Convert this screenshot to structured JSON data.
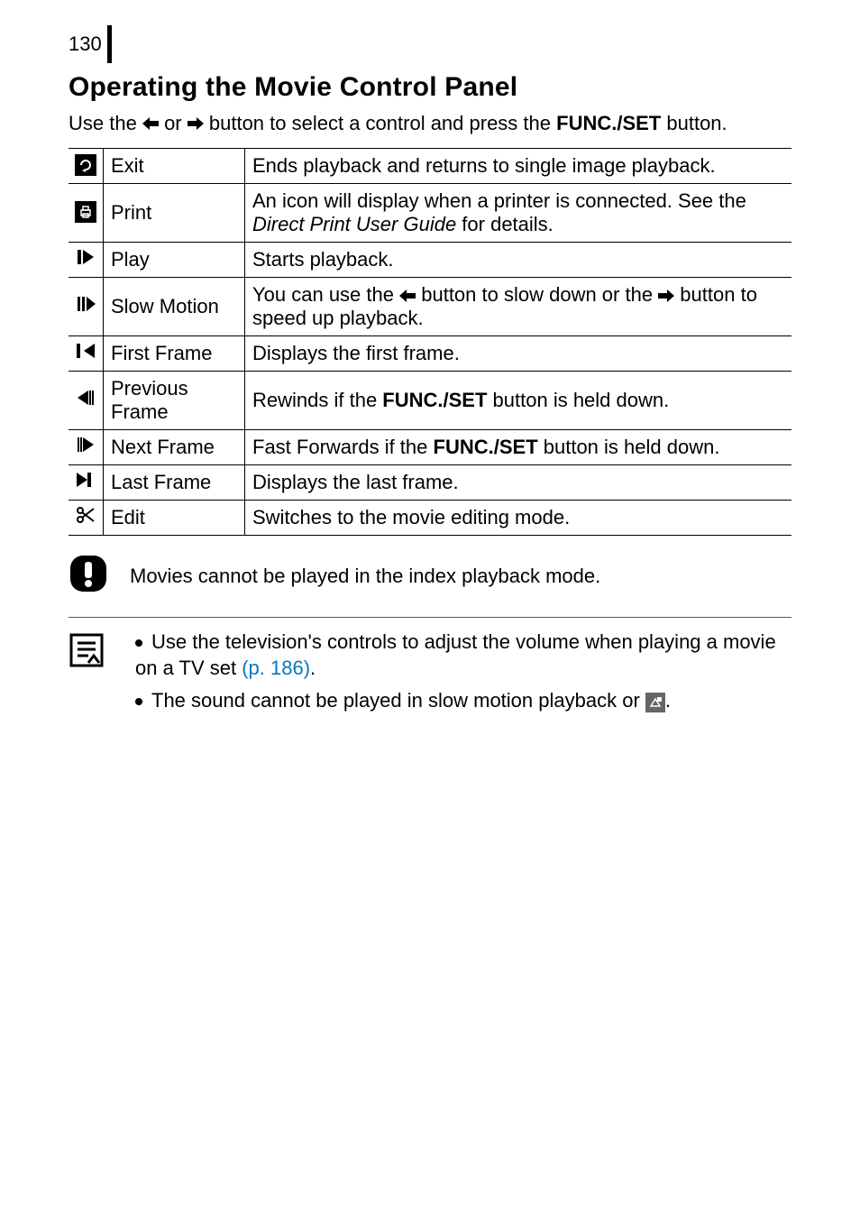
{
  "page_number": "130",
  "heading": "Operating the Movie Control Panel",
  "intro_prefix": "Use the ",
  "intro_mid": " or ",
  "intro_suffix": " button to select a control and press the ",
  "intro_button": "FUNC./SET",
  "intro_end": " button.",
  "rows": [
    {
      "name": "Exit",
      "desc_plain": "Ends playback and returns to single image playback."
    },
    {
      "name": "Print",
      "desc_prefix": "An icon will display when a printer is connected. See the ",
      "desc_italic": "Direct Print User Guide",
      "desc_suffix": " for details."
    },
    {
      "name": "Play",
      "desc_plain": "Starts playback."
    },
    {
      "name": "Slow Motion",
      "desc_prefix": "You can use the ",
      "desc_mid": " button to slow down or the ",
      "desc_suffix": " button to speed up playback."
    },
    {
      "name": "First Frame",
      "desc_plain": "Displays the first frame."
    },
    {
      "name": "Previous Frame",
      "desc_prefix": "Rewinds if the ",
      "desc_bold": "FUNC./SET",
      "desc_suffix": " button is held down."
    },
    {
      "name": "Next Frame",
      "desc_prefix": "Fast Forwards if the ",
      "desc_bold": "FUNC./SET",
      "desc_suffix": " button is held down."
    },
    {
      "name": "Last Frame",
      "desc_plain": "Displays the last frame."
    },
    {
      "name": "Edit",
      "desc_plain": "Switches to the movie editing mode."
    }
  ],
  "warning_text": "Movies cannot be played in the index playback mode.",
  "tip1_prefix": "Use the television's controls to adjust the volume when playing a movie on a TV set ",
  "tip1_link": "(p. 186)",
  "tip1_suffix": ".",
  "tip2_prefix": "The sound cannot be played in slow motion playback or ",
  "tip2_suffix": "."
}
